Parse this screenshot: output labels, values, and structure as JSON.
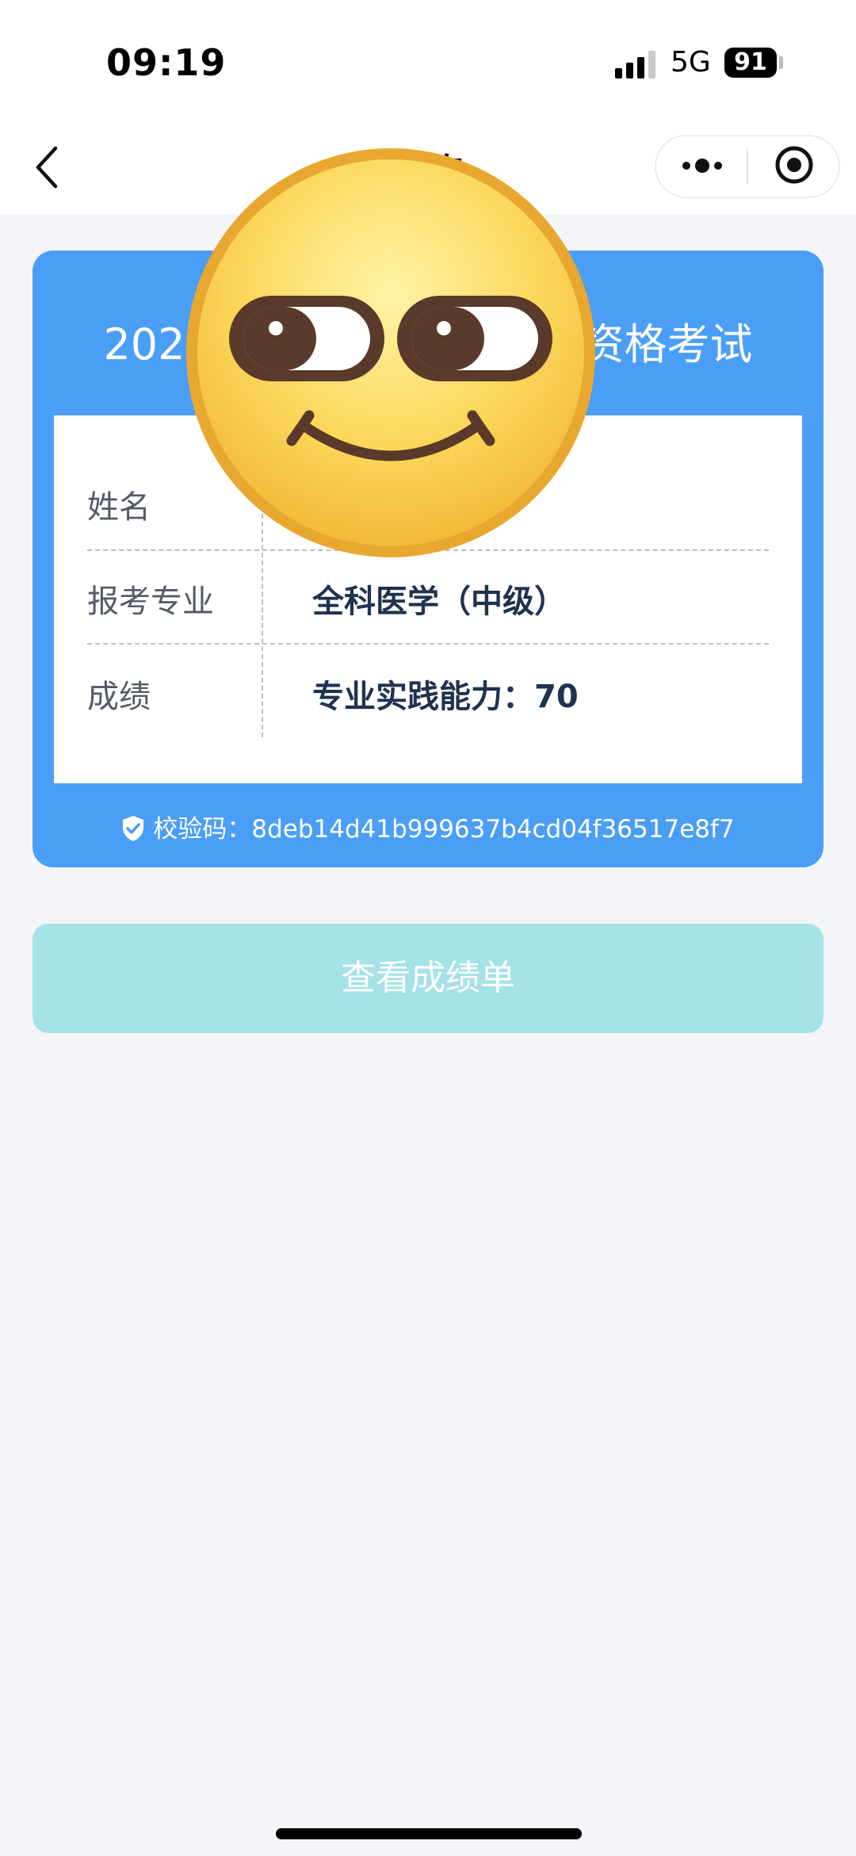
{
  "status_bar": {
    "time": "09:19",
    "network": "5G",
    "battery": "91"
  },
  "nav": {
    "title": "查询"
  },
  "card": {
    "title_left": "202",
    "title_right": "资格考试",
    "rows": [
      {
        "label": "姓名",
        "value": ""
      },
      {
        "label": "报考专业",
        "value": "全科医学（中级）"
      },
      {
        "label": "成绩",
        "value": "专业实践能力：70"
      }
    ],
    "verify_label": "校验码：",
    "verify_code": "8deb14d41b999637b4cd04f36517e8f7"
  },
  "button": {
    "label": "查看成绩单"
  },
  "colors": {
    "card_blue": "#4b9ef5",
    "button_teal": "#a4e2e7",
    "background": "#f3f5f9"
  },
  "icons": [
    "signal-icon",
    "back-chevron-icon",
    "more-icon",
    "target-icon",
    "shield-check-icon",
    "smile-emoji-sticker"
  ]
}
